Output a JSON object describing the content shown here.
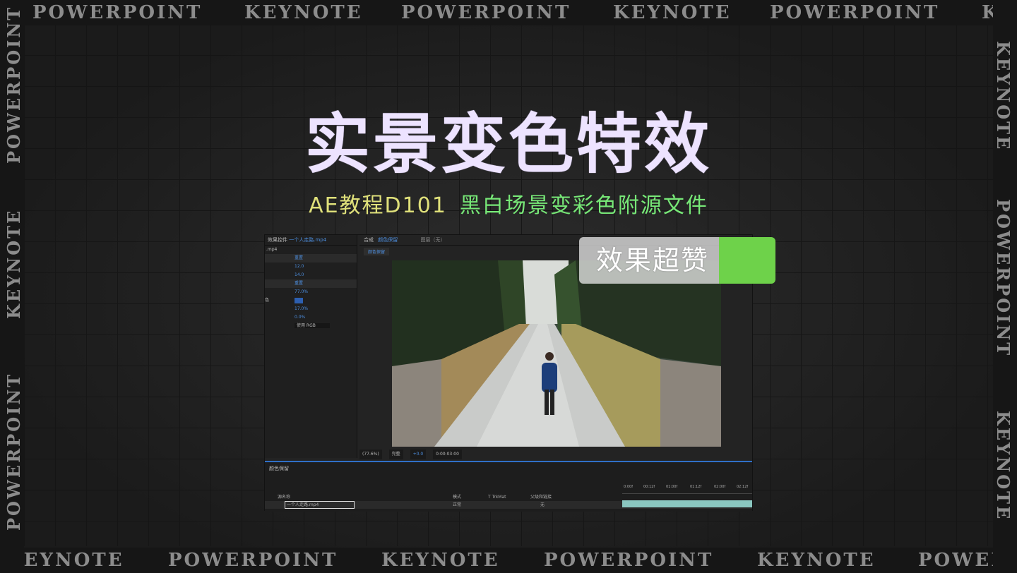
{
  "title": "实景变色特效",
  "subtitle": {
    "part1": "AE教程D101",
    "part2": "黑白场景变彩色附源文件"
  },
  "badge": "效果超赞",
  "bands": {
    "top": [
      "POWERPOINT",
      "KEYNOTE",
      "POWERPOINT",
      "KEYNOTE",
      "POWERPOINT",
      "KE"
    ],
    "bottom": [
      "KEYNOTE",
      "POWERPOINT",
      "KEYNOTE",
      "POWERPOINT",
      "KEYNOTE",
      "POWER"
    ],
    "left": [
      "POWERPOINT",
      "KEYNOTE",
      "POWERPOINT"
    ],
    "right": [
      "KEYNOTE",
      "POWERPOINT",
      "KEYNOTE"
    ]
  },
  "ae": {
    "effect_controls_tab": "效果控件",
    "effect_controls_file": "一个人走路.mp4",
    "file_ext": ".mp4",
    "effect_rows": [
      {
        "label": "",
        "value": "重置"
      },
      {
        "label": "",
        "value": "12.0"
      },
      {
        "label": "",
        "value": "14.0"
      },
      {
        "label": "",
        "value": "重置"
      },
      {
        "label": "",
        "value": "77.0%"
      },
      {
        "label": "色",
        "value": ""
      },
      {
        "label": "",
        "value": "17.0%"
      },
      {
        "label": "",
        "value": "0.0%"
      },
      {
        "label": "",
        "value": "使用 RGB"
      }
    ],
    "comp_tab": "合成",
    "comp_name": "颜色保留",
    "layer_tab": "图层（无）",
    "comp_sub": "颜色保留",
    "viewer_controls": [
      "(77.6%)",
      "完整",
      "+0.0",
      "0:00:03:00"
    ],
    "timeline_tab": "颜色保留",
    "timeline_headers": [
      "源名称",
      "模式",
      "T TrkMat",
      "父级和链接"
    ],
    "layer_name": "一个人走路.mp4",
    "layer_mode": "正常",
    "layer_parent": "无",
    "ruler_ticks": [
      "0:00f",
      "00:12f",
      "01:00f",
      "01:12f",
      "02:00f",
      "02:12f"
    ]
  },
  "colors": {
    "title": "#ede3ff",
    "subtitle_a": "#dfe07a",
    "subtitle_b": "#77e877",
    "badge_green": "#6ed24a",
    "ae_blue": "#4d8fe0"
  }
}
